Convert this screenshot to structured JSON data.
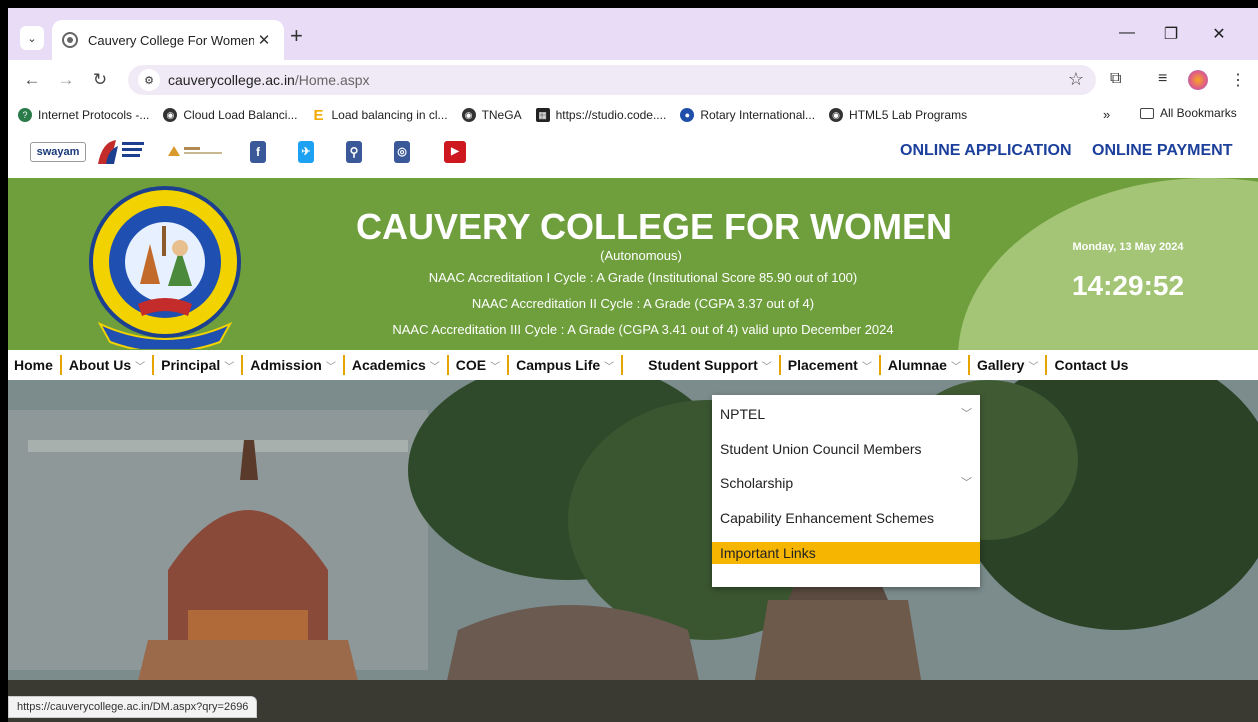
{
  "browser": {
    "tab": {
      "title": "Cauvery College For Women",
      "close": "✕"
    },
    "new_tab": "+",
    "url": {
      "host": "cauverycollege.ac.in",
      "path": "/Home.aspx"
    },
    "bookmarks": [
      {
        "label": "Internet Protocols -...",
        "icon": "internet-protocols-icon",
        "color": "#2a7a4a"
      },
      {
        "label": "Cloud Load Balanci...",
        "icon": "globe-icon",
        "color": "#333333"
      },
      {
        "label": "Load balancing in cl...",
        "icon": "e-letter-icon",
        "color": "#f2a900"
      },
      {
        "label": "TNeGA",
        "icon": "globe-icon",
        "color": "#333333"
      },
      {
        "label": "https://studio.code....",
        "icon": "grid-icon",
        "color": "#222222"
      },
      {
        "label": "Rotary International...",
        "icon": "rotary-icon",
        "color": "#1f4fa8"
      },
      {
        "label": "HTML5 Lab Programs",
        "icon": "globe-icon",
        "color": "#333333"
      }
    ],
    "bookmarks_more": "»",
    "all_bookmarks": "All Bookmarks",
    "status_url": "https://cauverycollege.ac.in/DM.aspx?qry=2696"
  },
  "site": {
    "top_links": {
      "online_application": "ONLINE APPLICATION",
      "online_payment": "ONLINE PAYMENT"
    },
    "swayam": "swayam",
    "banner": {
      "name": "CAUVERY COLLEGE FOR WOMEN",
      "sub": "(Autonomous)",
      "naac": [
        "NAAC Accreditation I Cycle : A Grade (Institutional Score 85.90 out of 100)",
        "NAAC Accreditation II Cycle : A Grade (CGPA 3.37 out of 4)",
        "NAAC Accreditation III Cycle : A Grade (CGPA 3.41 out of 4) valid upto December 2024"
      ],
      "date": "Monday, 13 May 2024",
      "time": "14:29:52"
    },
    "menu": [
      {
        "label": "Home",
        "chev": false
      },
      {
        "label": "About Us",
        "chev": true
      },
      {
        "label": "Principal",
        "chev": true
      },
      {
        "label": "Admission",
        "chev": true
      },
      {
        "label": "Academics",
        "chev": true
      },
      {
        "label": "COE",
        "chev": true
      },
      {
        "label": "Campus Life",
        "chev": true
      },
      {
        "label": "Student Support",
        "chev": true
      },
      {
        "label": "Placement",
        "chev": true
      },
      {
        "label": "Alumnae",
        "chev": true
      },
      {
        "label": "Gallery",
        "chev": true
      },
      {
        "label": "Contact Us",
        "chev": false
      }
    ],
    "dropdown": [
      {
        "label": "NPTEL",
        "chev": true
      },
      {
        "label": "Student Union Council Members",
        "chev": false
      },
      {
        "label": "Scholarship",
        "chev": true
      },
      {
        "label": "Capability Enhancement Schemes",
        "chev": false
      },
      {
        "label": "Important Links",
        "chev": false,
        "active": true
      }
    ]
  }
}
